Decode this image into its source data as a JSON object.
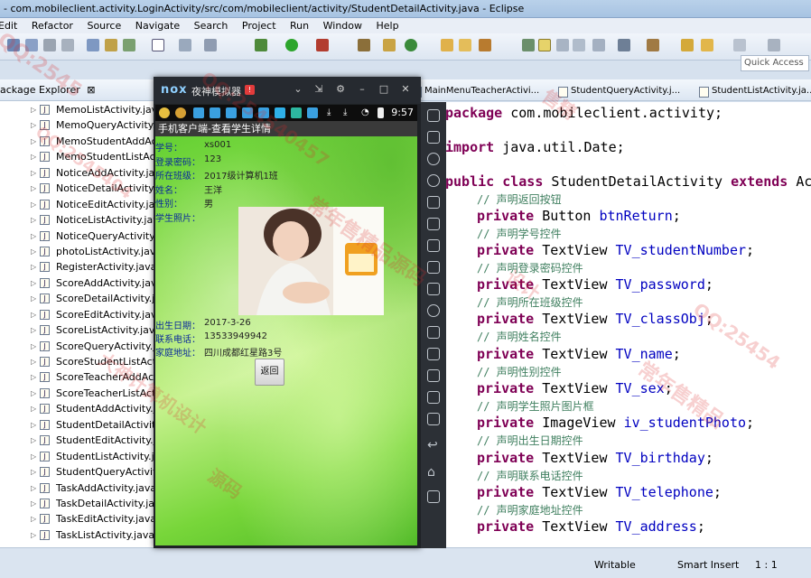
{
  "window": {
    "title": "- com.mobileclient.activity.LoginActivity/src/com/mobileclient/activity/StudentDetailActivity.java - Eclipse"
  },
  "menu": [
    "Edit",
    "Refactor",
    "Source",
    "Navigate",
    "Search",
    "Project",
    "Run",
    "Window",
    "Help"
  ],
  "quick_access": "Quick Access",
  "package_explorer": {
    "title": "ackage Explorer",
    "files": [
      "MemoListActivity.java",
      "MemoQueryActivity.java",
      "MemoStudentAddActivity.java",
      "MemoStudentListActivity.java",
      "NoticeAddActivity.java",
      "NoticeDetailActivity.java",
      "NoticeEditActivity.java",
      "NoticeListActivity.java",
      "NoticeQueryActivity.java",
      "photoListActivity.java",
      "RegisterActivity.java",
      "ScoreAddActivity.java",
      "ScoreDetailActivity.java",
      "ScoreEditActivity.java",
      "ScoreListActivity.java",
      "ScoreQueryActivity.java",
      "ScoreStudentListActivity.java",
      "ScoreTeacherAddActivity.java",
      "ScoreTeacherListActivity.java",
      "StudentAddActivity.java",
      "StudentDetailActivity.java",
      "StudentEditActivity.java",
      "StudentListActivity.java",
      "StudentQueryActivity.java",
      "TaskAddActivity.java",
      "TaskDetailActivity.java",
      "TaskEditActivity.java",
      "TaskListActivity.java"
    ]
  },
  "editor_tabs": [
    "MainMenuTeacherActivi...",
    "StudentQueryActivity.j...",
    "StudentListActivity.ja..."
  ],
  "code": [
    {
      "kw": "package",
      "rest": " com.mobileclient.activity;"
    },
    {
      "kw": "import",
      "rest": " java.util.Date;"
    },
    {
      "kw": "public class",
      "rest": " StudentDetailActivity ",
      "kw2": "extends",
      "rest2": " Acti"
    },
    {
      "comment": "// 声明返回按钮"
    },
    {
      "kw": "private",
      "type": " Button ",
      "field": "btnReturn",
      "end": ";"
    },
    {
      "comment": "// 声明学号控件"
    },
    {
      "kw": "private",
      "type": " TextView ",
      "field": "TV_studentNumber",
      "end": ";"
    },
    {
      "comment": "// 声明登录密码控件"
    },
    {
      "kw": "private",
      "type": " TextView ",
      "field": "TV_password",
      "end": ";"
    },
    {
      "comment": "// 声明所在班级控件"
    },
    {
      "kw": "private",
      "type": " TextView ",
      "field": "TV_classObj",
      "end": ";"
    },
    {
      "comment": "// 声明姓名控件"
    },
    {
      "kw": "private",
      "type": " TextView ",
      "field": "TV_name",
      "end": ";"
    },
    {
      "comment": "// 声明性别控件"
    },
    {
      "kw": "private",
      "type": " TextView ",
      "field": "TV_sex",
      "end": ";"
    },
    {
      "comment": "// 声明学生照片图片框"
    },
    {
      "kw": "private",
      "type": " ImageView ",
      "field": "iv_studentPhoto",
      "end": ";"
    },
    {
      "comment": "// 声明出生日期控件"
    },
    {
      "kw": "private",
      "type": " TextView ",
      "field": "TV_birthday",
      "end": ";"
    },
    {
      "comment": "// 声明联系电话控件"
    },
    {
      "kw": "private",
      "type": " TextView ",
      "field": "TV_telephone",
      "end": ";"
    },
    {
      "comment": "// 声明家庭地址控件"
    },
    {
      "kw": "private",
      "type": " TextView ",
      "field": "TV_address",
      "end": ";"
    }
  ],
  "status": {
    "writable": "Writable",
    "insert_mode": "Smart Insert",
    "position": "1 : 1"
  },
  "emulator": {
    "logo": "nox",
    "name": "夜神模拟器",
    "badge": "!",
    "time": "9:57"
  },
  "app": {
    "title": "手机客户端-查看学生详情",
    "fields": [
      {
        "label": "学号：",
        "value": "xs001"
      },
      {
        "label": "登录密码：",
        "value": "123"
      },
      {
        "label": "所在班级：",
        "value": "2017级计算机1班"
      },
      {
        "label": "姓名：",
        "value": "王洋"
      },
      {
        "label": "性别：",
        "value": "男"
      },
      {
        "label": "学生照片：",
        "value": ""
      }
    ],
    "bottom_fields": [
      {
        "label": "出生日期：",
        "value": "2017-3-26"
      },
      {
        "label": "联系电话：",
        "value": "13533949942"
      },
      {
        "label": "家庭地址：",
        "value": "四川成都红星路3号"
      }
    ],
    "back_button": "返回"
  },
  "watermarks": [
    "QQ:2545",
    "QQ:254540457",
    "常年售精品源码",
    "大神计算机设计",
    "设计",
    "QQ:2545404",
    "常年售精品",
    "QQ:25454",
    "售精",
    "源码"
  ]
}
